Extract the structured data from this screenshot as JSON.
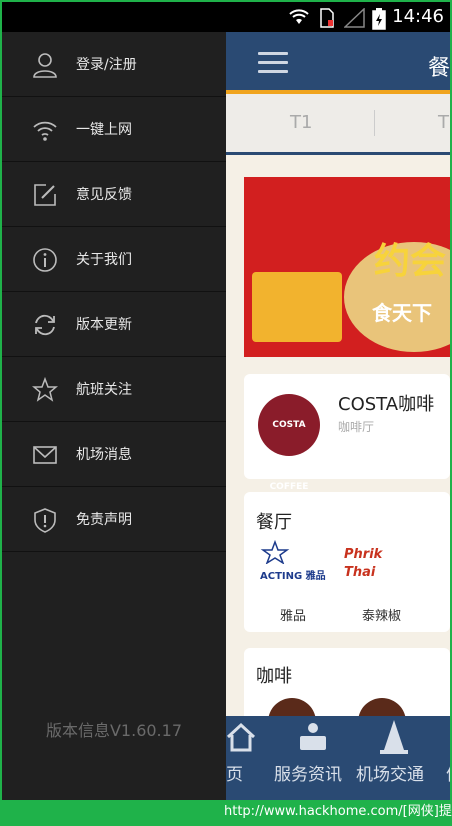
{
  "status_bar": {
    "time": "14:46"
  },
  "drawer": {
    "items": [
      {
        "label": "登录/注册",
        "icon": "user-icon"
      },
      {
        "label": "一键上网",
        "icon": "wifi-icon"
      },
      {
        "label": "意见反馈",
        "icon": "edit-icon"
      },
      {
        "label": "关于我们",
        "icon": "info-icon"
      },
      {
        "label": "版本更新",
        "icon": "refresh-icon"
      },
      {
        "label": "航班关注",
        "icon": "star-icon"
      },
      {
        "label": "机场消息",
        "icon": "mail-icon"
      },
      {
        "label": "免责声明",
        "icon": "shield-icon"
      }
    ],
    "version": "版本信息V1.60.17"
  },
  "app": {
    "title": "餐",
    "tabs": [
      "T1",
      "T"
    ],
    "banner": {
      "text1": "约会",
      "text2": "食天下"
    },
    "featured": {
      "logo_text": "COSTA COFFEE",
      "name": "COSTA咖啡",
      "category": "咖啡厅"
    },
    "restaurants": {
      "title": "餐厅",
      "items": [
        {
          "logo_text": "ACTING 雅品",
          "name": "雅品"
        },
        {
          "logo_text": "Phrik Thai",
          "name": "泰辣椒"
        }
      ]
    },
    "cafes": {
      "title": "咖啡"
    },
    "bottom_nav": [
      {
        "label": "页",
        "icon": "home-icon"
      },
      {
        "label": "服务资讯",
        "icon": "service-icon"
      },
      {
        "label": "机场交通",
        "icon": "traffic-cone-icon"
      },
      {
        "label": "信",
        "icon": "info-icon"
      }
    ]
  },
  "watermark": "http://www.hackhome.com/[网侠]提供",
  "colors": {
    "drawer_bg": "#202020",
    "header_bg": "#2a4a73",
    "accent": "#f0a41e",
    "frame": "#1fb24a"
  }
}
